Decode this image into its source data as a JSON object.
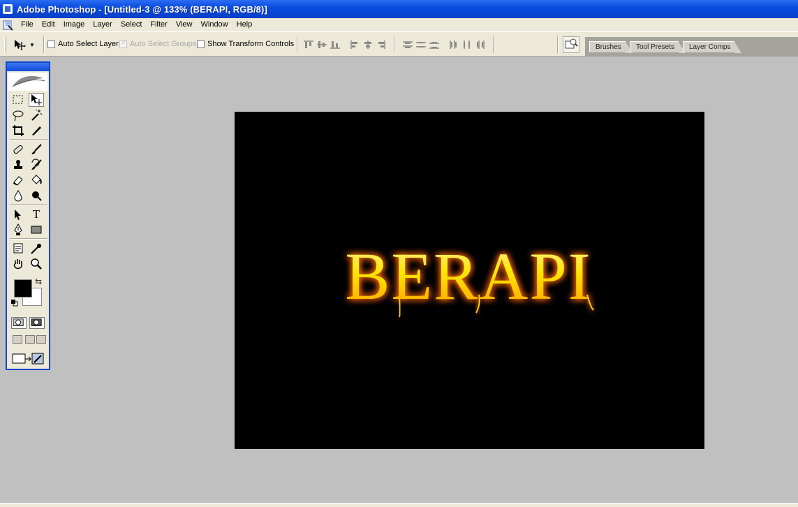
{
  "window": {
    "title": "Adobe Photoshop - [Untitled-3 @ 133% (BERAPI, RGB/8)]"
  },
  "menu": {
    "items": [
      {
        "label": "File"
      },
      {
        "label": "Edit"
      },
      {
        "label": "Image"
      },
      {
        "label": "Layer"
      },
      {
        "label": "Select"
      },
      {
        "label": "Filter"
      },
      {
        "label": "View"
      },
      {
        "label": "Window"
      },
      {
        "label": "Help"
      }
    ]
  },
  "options": {
    "auto_select_layer": {
      "label": "Auto Select Layer",
      "checked": false
    },
    "auto_select_groups": {
      "label": "Auto Select Groups",
      "checked": true,
      "enabled": false
    },
    "show_transform": {
      "label": "Show Transform Controls",
      "checked": false
    }
  },
  "palette_well": {
    "tabs": [
      {
        "label": "Brushes"
      },
      {
        "label": "Tool Presets"
      },
      {
        "label": "Layer Comps"
      }
    ]
  },
  "toolbox": {
    "tools": [
      {
        "icon": "rectangular-marquee-icon"
      },
      {
        "icon": "move-icon",
        "active": true
      },
      {
        "icon": "lasso-icon"
      },
      {
        "icon": "magic-wand-icon"
      },
      {
        "icon": "crop-icon"
      },
      {
        "icon": "slice-icon"
      },
      {
        "icon": "healing-brush-icon"
      },
      {
        "icon": "brush-icon"
      },
      {
        "icon": "clone-stamp-icon"
      },
      {
        "icon": "history-brush-icon"
      },
      {
        "icon": "eraser-icon"
      },
      {
        "icon": "paint-bucket-icon"
      },
      {
        "icon": "blur-icon"
      },
      {
        "icon": "dodge-icon"
      },
      {
        "icon": "path-selection-icon"
      },
      {
        "icon": "type-icon"
      },
      {
        "icon": "pen-icon"
      },
      {
        "icon": "rectangle-shape-icon"
      },
      {
        "icon": "notes-icon"
      },
      {
        "icon": "eyedropper-icon"
      },
      {
        "icon": "hand-icon"
      },
      {
        "icon": "zoom-icon"
      }
    ],
    "foreground_color": "#000000",
    "background_color": "#ffffff",
    "type_tool_glyph": "T"
  },
  "document": {
    "text": "BERAPI",
    "text_color": "#ffe600",
    "glow_color": "#ff6a00",
    "background": "#000000"
  },
  "colors": {
    "titlebar": "#0a4ddf",
    "chrome": "#ece9d8",
    "workspace": "#c0c0c0"
  }
}
